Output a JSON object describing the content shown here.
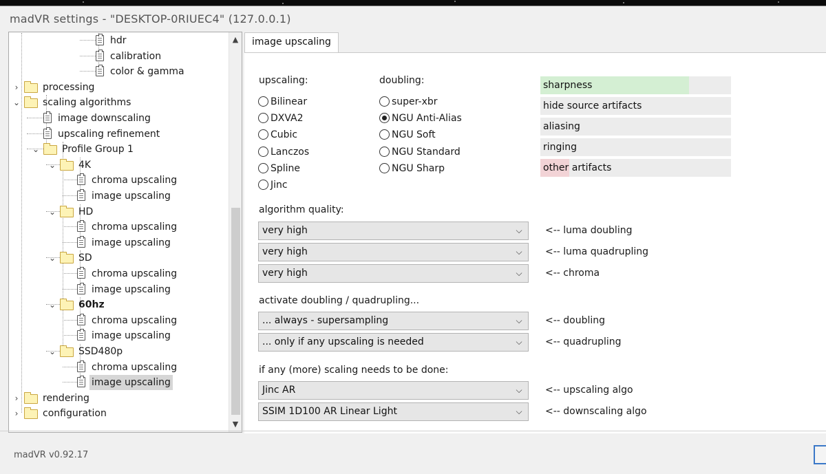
{
  "window": {
    "title": "madVR settings - \"DESKTOP-0RIUEC4\" (127.0.0.1)",
    "version": "madVR v0.92.17"
  },
  "tree": [
    {
      "label": "hdr",
      "type": "file",
      "level": 4
    },
    {
      "label": "calibration",
      "type": "file",
      "level": 4
    },
    {
      "label": "color & gamma",
      "type": "file",
      "level": 4
    },
    {
      "label": "processing",
      "type": "folder",
      "level": 0,
      "expander": "›"
    },
    {
      "label": "scaling algorithms",
      "type": "folder",
      "level": 0,
      "expander": "⌄"
    },
    {
      "label": "image downscaling",
      "type": "file",
      "level": 1
    },
    {
      "label": "upscaling refinement",
      "type": "file",
      "level": 1
    },
    {
      "label": "Profile Group 1",
      "type": "folder",
      "level": 1,
      "expander": "⌄"
    },
    {
      "label": "4K",
      "type": "folder",
      "level": 2,
      "expander": "⌄"
    },
    {
      "label": "chroma upscaling",
      "type": "file",
      "level": 3
    },
    {
      "label": "image upscaling",
      "type": "file",
      "level": 3
    },
    {
      "label": "HD",
      "type": "folder",
      "level": 2,
      "expander": "⌄"
    },
    {
      "label": "chroma upscaling",
      "type": "file",
      "level": 3
    },
    {
      "label": "image upscaling",
      "type": "file",
      "level": 3
    },
    {
      "label": "SD",
      "type": "folder",
      "level": 2,
      "expander": "⌄"
    },
    {
      "label": "chroma upscaling",
      "type": "file",
      "level": 3
    },
    {
      "label": "image upscaling",
      "type": "file",
      "level": 3
    },
    {
      "label": "60hz",
      "type": "folder",
      "level": 2,
      "expander": "⌄",
      "bold": true
    },
    {
      "label": "chroma upscaling",
      "type": "file",
      "level": 3
    },
    {
      "label": "image upscaling",
      "type": "file",
      "level": 3
    },
    {
      "label": "SSD480p",
      "type": "folder",
      "level": 2,
      "expander": "⌄"
    },
    {
      "label": "chroma upscaling",
      "type": "file",
      "level": 3
    },
    {
      "label": "image upscaling",
      "type": "file",
      "level": 3,
      "selected": true
    },
    {
      "label": "rendering",
      "type": "folder",
      "level": 0,
      "expander": "›"
    },
    {
      "label": "configuration",
      "type": "folder",
      "level": 0,
      "expander": "›"
    }
  ],
  "tab": {
    "label": "image upscaling"
  },
  "upscaling": {
    "heading": "upscaling:",
    "options": [
      {
        "label": "Bilinear",
        "selected": false
      },
      {
        "label": "DXVA2",
        "selected": false
      },
      {
        "label": "Cubic",
        "selected": false
      },
      {
        "label": "Lanczos",
        "selected": false
      },
      {
        "label": "Spline",
        "selected": false
      },
      {
        "label": "Jinc",
        "selected": false
      }
    ]
  },
  "doubling": {
    "heading": "doubling:",
    "options": [
      {
        "label": "super-xbr",
        "selected": false
      },
      {
        "label": "NGU Anti-Alias",
        "selected": true
      },
      {
        "label": "NGU Soft",
        "selected": false
      },
      {
        "label": "NGU Standard",
        "selected": false
      },
      {
        "label": "NGU Sharp",
        "selected": false
      }
    ]
  },
  "quality_bars": [
    {
      "label": "sharpness",
      "fill_fraction": 0.78,
      "color": "#d4efd3"
    },
    {
      "label": "hide source artifacts",
      "fill_fraction": 0.0,
      "color": "#ececec"
    },
    {
      "label": "aliasing",
      "fill_fraction": 0.0,
      "color": "#ececec"
    },
    {
      "label": "ringing",
      "fill_fraction": 0.0,
      "color": "#ececec"
    },
    {
      "label": "other artifacts",
      "fill_fraction": 0.15,
      "color": "#f2d3d6"
    }
  ],
  "algorithm_quality": {
    "heading": "algorithm quality:",
    "rows": [
      {
        "value": "very high",
        "note": "<-- luma doubling"
      },
      {
        "value": "very high",
        "note": "<-- luma quadrupling"
      },
      {
        "value": "very high",
        "note": "<-- chroma"
      }
    ]
  },
  "activate": {
    "heading": "activate doubling / quadrupling...",
    "rows": [
      {
        "value": "... always - supersampling",
        "note": "<-- doubling"
      },
      {
        "value": "... only if any upscaling is needed",
        "note": "<-- quadrupling"
      }
    ]
  },
  "more_scaling": {
    "heading": "if any (more) scaling needs to be done:",
    "rows": [
      {
        "value": "Jinc AR",
        "note": "<-- upscaling algo"
      },
      {
        "value": "SSIM 1D100 AR Linear Light",
        "note": "<-- downscaling algo"
      }
    ]
  },
  "icons": {
    "scroll_up": "▲",
    "scroll_down": "▼",
    "combo_chevron": "⌵"
  }
}
